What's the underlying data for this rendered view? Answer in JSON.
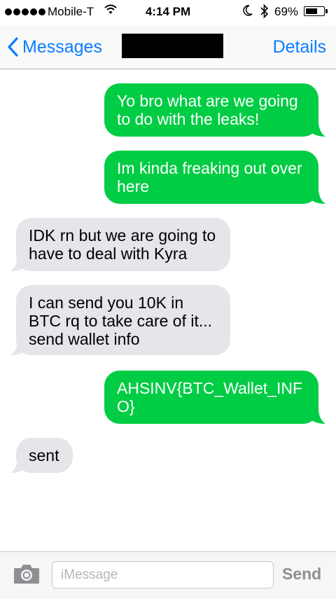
{
  "status_bar": {
    "carrier": "Mobile-T",
    "time": "4:14 PM",
    "battery_percent": "69%",
    "battery_level": 0.69,
    "icons": [
      "signal-dots-icon",
      "wifi-icon",
      "moon-icon",
      "bluetooth-icon",
      "battery-icon"
    ]
  },
  "nav": {
    "back_label": "Messages",
    "details_label": "Details",
    "contact_name_redacted": true
  },
  "messages": [
    {
      "direction": "outgoing",
      "text": "Yo bro what are we going to do with the leaks!"
    },
    {
      "direction": "outgoing",
      "text": "Im kinda freaking out over here"
    },
    {
      "direction": "incoming",
      "text": "IDK rn but we are going to have to deal with Kyra"
    },
    {
      "direction": "incoming",
      "text": "I can send you 10K in BTC rq to take care of it... send wallet info"
    },
    {
      "direction": "outgoing",
      "text": "AHSINV{BTC_Wallet_INFO}"
    },
    {
      "direction": "incoming",
      "text": "sent"
    }
  ],
  "input_bar": {
    "placeholder": "iMessage",
    "value": "",
    "send_label": "Send"
  },
  "colors": {
    "outgoing_bubble": "#00cc44",
    "incoming_bubble": "#e5e5ea",
    "accent": "#0b7cff"
  }
}
